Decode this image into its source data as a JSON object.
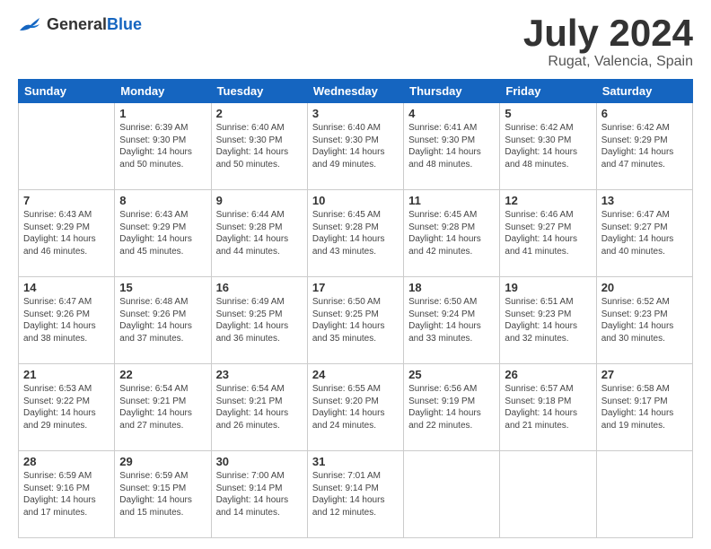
{
  "header": {
    "logo_general": "General",
    "logo_blue": "Blue",
    "month": "July 2024",
    "location": "Rugat, Valencia, Spain"
  },
  "days_of_week": [
    "Sunday",
    "Monday",
    "Tuesday",
    "Wednesday",
    "Thursday",
    "Friday",
    "Saturday"
  ],
  "weeks": [
    [
      {
        "day": "",
        "info": ""
      },
      {
        "day": "1",
        "info": "Sunrise: 6:39 AM\nSunset: 9:30 PM\nDaylight: 14 hours\nand 50 minutes."
      },
      {
        "day": "2",
        "info": "Sunrise: 6:40 AM\nSunset: 9:30 PM\nDaylight: 14 hours\nand 50 minutes."
      },
      {
        "day": "3",
        "info": "Sunrise: 6:40 AM\nSunset: 9:30 PM\nDaylight: 14 hours\nand 49 minutes."
      },
      {
        "day": "4",
        "info": "Sunrise: 6:41 AM\nSunset: 9:30 PM\nDaylight: 14 hours\nand 48 minutes."
      },
      {
        "day": "5",
        "info": "Sunrise: 6:42 AM\nSunset: 9:30 PM\nDaylight: 14 hours\nand 48 minutes."
      },
      {
        "day": "6",
        "info": "Sunrise: 6:42 AM\nSunset: 9:29 PM\nDaylight: 14 hours\nand 47 minutes."
      }
    ],
    [
      {
        "day": "7",
        "info": "Sunrise: 6:43 AM\nSunset: 9:29 PM\nDaylight: 14 hours\nand 46 minutes."
      },
      {
        "day": "8",
        "info": "Sunrise: 6:43 AM\nSunset: 9:29 PM\nDaylight: 14 hours\nand 45 minutes."
      },
      {
        "day": "9",
        "info": "Sunrise: 6:44 AM\nSunset: 9:28 PM\nDaylight: 14 hours\nand 44 minutes."
      },
      {
        "day": "10",
        "info": "Sunrise: 6:45 AM\nSunset: 9:28 PM\nDaylight: 14 hours\nand 43 minutes."
      },
      {
        "day": "11",
        "info": "Sunrise: 6:45 AM\nSunset: 9:28 PM\nDaylight: 14 hours\nand 42 minutes."
      },
      {
        "day": "12",
        "info": "Sunrise: 6:46 AM\nSunset: 9:27 PM\nDaylight: 14 hours\nand 41 minutes."
      },
      {
        "day": "13",
        "info": "Sunrise: 6:47 AM\nSunset: 9:27 PM\nDaylight: 14 hours\nand 40 minutes."
      }
    ],
    [
      {
        "day": "14",
        "info": "Sunrise: 6:47 AM\nSunset: 9:26 PM\nDaylight: 14 hours\nand 38 minutes."
      },
      {
        "day": "15",
        "info": "Sunrise: 6:48 AM\nSunset: 9:26 PM\nDaylight: 14 hours\nand 37 minutes."
      },
      {
        "day": "16",
        "info": "Sunrise: 6:49 AM\nSunset: 9:25 PM\nDaylight: 14 hours\nand 36 minutes."
      },
      {
        "day": "17",
        "info": "Sunrise: 6:50 AM\nSunset: 9:25 PM\nDaylight: 14 hours\nand 35 minutes."
      },
      {
        "day": "18",
        "info": "Sunrise: 6:50 AM\nSunset: 9:24 PM\nDaylight: 14 hours\nand 33 minutes."
      },
      {
        "day": "19",
        "info": "Sunrise: 6:51 AM\nSunset: 9:23 PM\nDaylight: 14 hours\nand 32 minutes."
      },
      {
        "day": "20",
        "info": "Sunrise: 6:52 AM\nSunset: 9:23 PM\nDaylight: 14 hours\nand 30 minutes."
      }
    ],
    [
      {
        "day": "21",
        "info": "Sunrise: 6:53 AM\nSunset: 9:22 PM\nDaylight: 14 hours\nand 29 minutes."
      },
      {
        "day": "22",
        "info": "Sunrise: 6:54 AM\nSunset: 9:21 PM\nDaylight: 14 hours\nand 27 minutes."
      },
      {
        "day": "23",
        "info": "Sunrise: 6:54 AM\nSunset: 9:21 PM\nDaylight: 14 hours\nand 26 minutes."
      },
      {
        "day": "24",
        "info": "Sunrise: 6:55 AM\nSunset: 9:20 PM\nDaylight: 14 hours\nand 24 minutes."
      },
      {
        "day": "25",
        "info": "Sunrise: 6:56 AM\nSunset: 9:19 PM\nDaylight: 14 hours\nand 22 minutes."
      },
      {
        "day": "26",
        "info": "Sunrise: 6:57 AM\nSunset: 9:18 PM\nDaylight: 14 hours\nand 21 minutes."
      },
      {
        "day": "27",
        "info": "Sunrise: 6:58 AM\nSunset: 9:17 PM\nDaylight: 14 hours\nand 19 minutes."
      }
    ],
    [
      {
        "day": "28",
        "info": "Sunrise: 6:59 AM\nSunset: 9:16 PM\nDaylight: 14 hours\nand 17 minutes."
      },
      {
        "day": "29",
        "info": "Sunrise: 6:59 AM\nSunset: 9:15 PM\nDaylight: 14 hours\nand 15 minutes."
      },
      {
        "day": "30",
        "info": "Sunrise: 7:00 AM\nSunset: 9:14 PM\nDaylight: 14 hours\nand 14 minutes."
      },
      {
        "day": "31",
        "info": "Sunrise: 7:01 AM\nSunset: 9:14 PM\nDaylight: 14 hours\nand 12 minutes."
      },
      {
        "day": "",
        "info": ""
      },
      {
        "day": "",
        "info": ""
      },
      {
        "day": "",
        "info": ""
      }
    ]
  ]
}
